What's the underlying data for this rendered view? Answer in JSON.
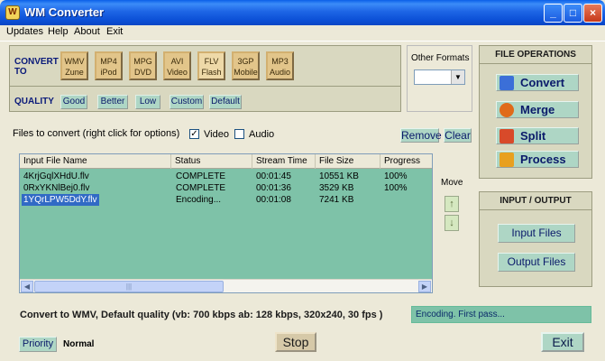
{
  "window": {
    "title": "WM Converter",
    "icon_text": "W"
  },
  "menu": [
    "Updates",
    "Help",
    "About",
    "Exit"
  ],
  "convert": {
    "label_line1": "CONVERT",
    "label_line2": "TO",
    "formats": [
      {
        "l1": "WMV",
        "l2": "Zune"
      },
      {
        "l1": "MP4",
        "l2": "iPod"
      },
      {
        "l1": "MPG",
        "l2": "DVD"
      },
      {
        "l1": "AVI",
        "l2": "Video"
      },
      {
        "l1": "FLV",
        "l2": "Flash"
      },
      {
        "l1": "3GP",
        "l2": "Mobile"
      },
      {
        "l1": "MP3",
        "l2": "Audio"
      }
    ],
    "quality_label": "QUALITY",
    "quality_options": [
      "Good",
      "Better",
      "Low",
      "Custom",
      "Default"
    ]
  },
  "other_formats": {
    "label": "Other Formats",
    "value": ""
  },
  "file_operations": {
    "title": "FILE OPERATIONS",
    "buttons": [
      "Convert",
      "Merge",
      "Split",
      "Process"
    ],
    "icon_colors": [
      "#3b6fd8",
      "#e06a1a",
      "#d84a2a",
      "#e8a020"
    ]
  },
  "input_output": {
    "title": "INPUT / OUTPUT",
    "buttons": [
      "Input Files",
      "Output Files"
    ]
  },
  "files": {
    "label": "Files to convert (right click for options)",
    "video_label": "Video",
    "video_checked": true,
    "audio_label": "Audio",
    "audio_checked": false,
    "remove_label": "Remove",
    "clear_label": "Clear",
    "columns": [
      "Input File Name",
      "Status",
      "Stream Time",
      "File Size",
      "Progress"
    ],
    "rows": [
      {
        "name": "4KrjGqlXHdU.flv",
        "status": "COMPLETE",
        "time": "00:01:45",
        "size": "10551 KB",
        "progress": "100%",
        "selected": false
      },
      {
        "name": "0RxYKNlBej0.flv",
        "status": "COMPLETE",
        "time": "00:01:36",
        "size": "3529 KB",
        "progress": "100%",
        "selected": false
      },
      {
        "name": "1YQrLPW5DdY.flv",
        "status": "Encoding...",
        "time": "00:01:08",
        "size": "7241 KB",
        "progress": "",
        "selected": true
      }
    ]
  },
  "move": {
    "label": "Move"
  },
  "settings_text": "Convert to WMV, Default quality (vb: 700 kbps ab: 128 kbps, 320x240, 30 fps )",
  "status_text": "Encoding. First pass...",
  "priority": {
    "button": "Priority",
    "value": "Normal"
  },
  "stop_label": "Stop",
  "exit_label": "Exit",
  "colors": {
    "accent_green": "#7ec2a8",
    "button_green": "#aed6c5",
    "panel": "#d9d8c0",
    "title_blue": "#0a5fe8"
  }
}
